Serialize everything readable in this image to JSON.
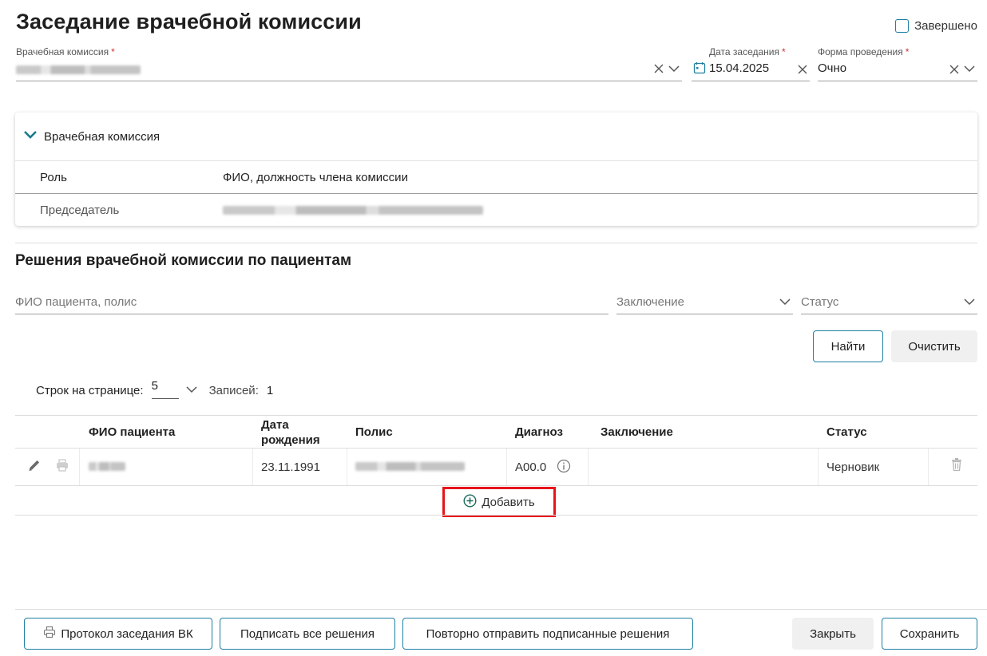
{
  "page": {
    "title": "Заседание врачебной комиссии",
    "completed_label": "Завершено"
  },
  "form": {
    "commission_label": "Врачебная комиссия",
    "date_label": "Дата заседания",
    "date_value": "15.04.2025",
    "mode_label": "Форма проведения",
    "mode_value": "Очно",
    "required_mark": "*"
  },
  "panel": {
    "title": "Врачебная комиссия",
    "col_role": "Роль",
    "col_member": "ФИО, должность члена комиссии",
    "rows": [
      {
        "role": "Председатель"
      }
    ]
  },
  "decisions": {
    "title": "Решения врачебной комиссии по пациентам",
    "filter_patient_placeholder": "ФИО пациента, полис",
    "filter_conclusion_placeholder": "Заключение",
    "filter_status_placeholder": "Статус",
    "find_label": "Найти",
    "clear_label": "Очистить",
    "rows_per_page_label": "Строк на странице:",
    "rows_per_page_value": "5",
    "records_label": "Записей:",
    "records_value": "1",
    "columns": {
      "patient": "ФИО пациента",
      "birth_1": "Дата",
      "birth_2": "рождения",
      "policy": "Полис",
      "diagnosis": "Диагноз",
      "conclusion": "Заключение",
      "status": "Статус"
    },
    "rows": [
      {
        "birth": "23.11.1991",
        "diagnosis": "А00.0",
        "conclusion": "",
        "status": "Черновик"
      }
    ],
    "add_label": "Добавить"
  },
  "footer": {
    "protocol_label": "Протокол заседания ВК",
    "sign_all_label": "Подписать все решения",
    "resend_label": "Повторно отправить подписанные решения",
    "close_label": "Закрыть",
    "save_label": "Сохранить"
  },
  "colors": {
    "accent": "#1e7fa3",
    "highlight": "#e8141b",
    "chevron": "#1a7a8c"
  }
}
